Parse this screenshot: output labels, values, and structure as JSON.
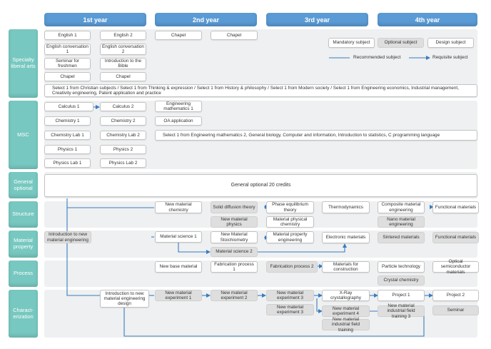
{
  "years": [
    "1st year",
    "2nd year",
    "3rd year",
    "4th year"
  ],
  "categories": {
    "specialty": "Specialty liberal arts",
    "msc": "MSC",
    "general": "General optional",
    "structure": "Structure",
    "material": "Material property",
    "process": "Process",
    "characterization": "Charact-erization"
  },
  "legend": {
    "mandatory": "Mandatory subject",
    "optional": "Optional subject",
    "design": "Design subject",
    "recommended": "Recommended subject",
    "requisite": "Requisite subject"
  },
  "specialty": {
    "english1": "English 1",
    "english2": "English 2",
    "chapel1": "Chapel",
    "chapel2": "Chapel",
    "engconv1": "English conversation 1",
    "engconv2": "English conversation 2",
    "seminar_freshmen": "Seminar for freshmen",
    "intro_bible": "Introduction to the Bible",
    "chapel3": "Chapel",
    "chapel4": "Chapel",
    "select_line": "Select 1 from Christian subjects / Select 1 from Thinking & expression / Select 1 from History & philosophy / Select 1 from Modern society / Select 1 from Engineering economics, Industrial management, Creativity engineering, Patent application and practice"
  },
  "msc": {
    "calculus1": "Calculus 1",
    "calculus2": "Calculus 2",
    "eng_math1": "Engineering mathematics 1",
    "chem1": "Chemistry 1",
    "chem2": "Chemistry 2",
    "oa": "OA application",
    "chemlab1": "Chemistry Lab 1",
    "chemlab2": "Chemistry Lab 2",
    "select_line": "Select 1 from Engineering mathematics 2, General biology, Computer and information, Introduction to statistics, C programming language",
    "phys1": "Physics 1",
    "phys2": "Physics 2",
    "physlab1": "Physics Lab 1",
    "physlab2": "Physics Lab 2"
  },
  "general": {
    "label": "General optional 20 credits"
  },
  "structure": {
    "new_chem": "New material chemistry",
    "solid_diff": "Solid diffusion theory",
    "phase_eq": "Phase equilibrium theory",
    "thermo": "Thermodynamics",
    "composite": "Composite material engineering",
    "functional": "Functional materials",
    "new_phys": "New material physics",
    "mat_phys_chem": "Material physical chemistry",
    "nano": "Nano material engineering"
  },
  "material": {
    "intro_eng": "Introduction to new material engineering",
    "ms1": "Material science 1",
    "stoich": "New Material Stoichiometry",
    "prop_eng": "Material property engineering",
    "electronic": "Electronic materials",
    "sintered": "Sintered materials",
    "functional2": "Functional materials",
    "ms2": "Material science 2"
  },
  "process": {
    "new_base": "New base material",
    "fab1": "Fabrication process 1",
    "fab2": "Fabrication process 2",
    "construction": "Materials for construction",
    "particle": "Particle technology",
    "optical": "Optical semiconductor materials",
    "crystal": "Crystal chemistry"
  },
  "characterization": {
    "intro_design": "Introduction to new material engineering design",
    "exp1": "New material experiment 1",
    "exp2": "New material experiment 2",
    "exp3a": "New material experiment 3",
    "xray": "X-Ray crystallography",
    "project1": "Project 1",
    "project2": "Project 2",
    "exp3b": "New material experiment 3",
    "exp4": "New material experiment 4",
    "training3": "New material industrial field training 3",
    "seminar": "Seminar",
    "training": "New material industrial field training"
  },
  "colors": {
    "year_header": "#5b9bd5",
    "category": "#77c8c0",
    "arrow": "#3a7cc0",
    "band": "#eef0f1",
    "optional_fill": "#dedede"
  }
}
